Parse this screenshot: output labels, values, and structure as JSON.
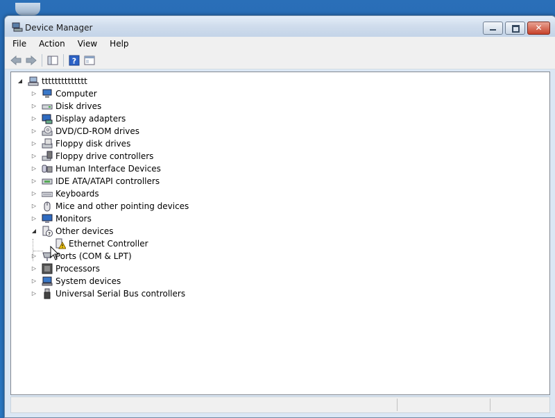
{
  "window": {
    "title": "Device Manager"
  },
  "menu": [
    "File",
    "Action",
    "View",
    "Help"
  ],
  "tree": {
    "root": "tttttttttttttt",
    "items": [
      {
        "label": "Computer",
        "icon": "computer-icon",
        "expanded": false
      },
      {
        "label": "Disk drives",
        "icon": "disk-drive-icon",
        "expanded": false
      },
      {
        "label": "Display adapters",
        "icon": "display-adapter-icon",
        "expanded": false
      },
      {
        "label": "DVD/CD-ROM drives",
        "icon": "dvd-drive-icon",
        "expanded": false
      },
      {
        "label": "Floppy disk drives",
        "icon": "floppy-disk-icon",
        "expanded": false
      },
      {
        "label": "Floppy drive controllers",
        "icon": "floppy-controller-icon",
        "expanded": false
      },
      {
        "label": "Human Interface Devices",
        "icon": "hid-icon",
        "expanded": false
      },
      {
        "label": "IDE ATA/ATAPI controllers",
        "icon": "ide-controller-icon",
        "expanded": false
      },
      {
        "label": "Keyboards",
        "icon": "keyboard-icon",
        "expanded": false
      },
      {
        "label": "Mice and other pointing devices",
        "icon": "mouse-icon",
        "expanded": false
      },
      {
        "label": "Monitors",
        "icon": "monitor-icon",
        "expanded": false
      },
      {
        "label": "Other devices",
        "icon": "unknown-device-icon",
        "expanded": true
      },
      {
        "label": "Ethernet Controller",
        "icon": "warning-device-icon",
        "child": true
      },
      {
        "label": "Ports (COM & LPT)",
        "icon": "port-icon",
        "expanded": false
      },
      {
        "label": "Processors",
        "icon": "processor-icon",
        "expanded": false
      },
      {
        "label": "System devices",
        "icon": "system-device-icon",
        "expanded": false
      },
      {
        "label": "Universal Serial Bus controllers",
        "icon": "usb-icon",
        "expanded": false
      }
    ]
  }
}
